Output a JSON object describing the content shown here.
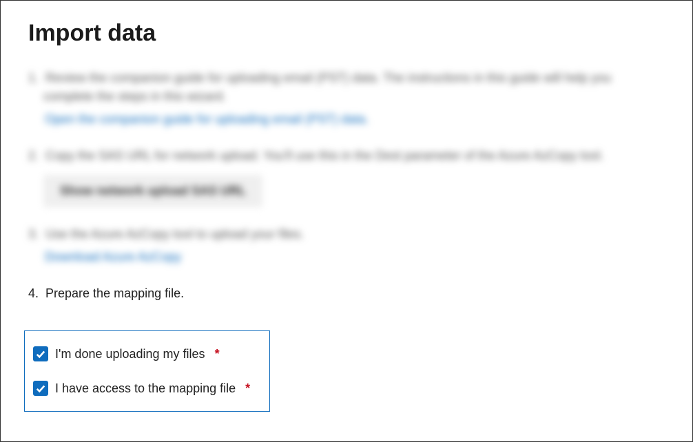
{
  "title": "Import data",
  "steps": {
    "one": {
      "num": "1.",
      "text": "Review the companion guide for uploading email (PST) data. The instructions in this guide will help you complete the steps in this wizard.",
      "link": "Open the companion guide for uploading email (PST) data."
    },
    "two": {
      "num": "2.",
      "text": "Copy the SAS URL for network upload. You'll use this in the Dest parameter of the Azure AzCopy tool.",
      "button": "Show network upload SAS URL"
    },
    "three": {
      "num": "3.",
      "text": "Use the Azure AzCopy tool to upload your files.",
      "link": "Download Azure AzCopy"
    },
    "four": {
      "num": "4.",
      "text": "Prepare the mapping file."
    }
  },
  "checkboxes": {
    "done_uploading": {
      "label": "I'm done uploading my files",
      "required": "*",
      "checked": true
    },
    "mapping_access": {
      "label": "I have access to the mapping file",
      "required": "*",
      "checked": true
    }
  }
}
